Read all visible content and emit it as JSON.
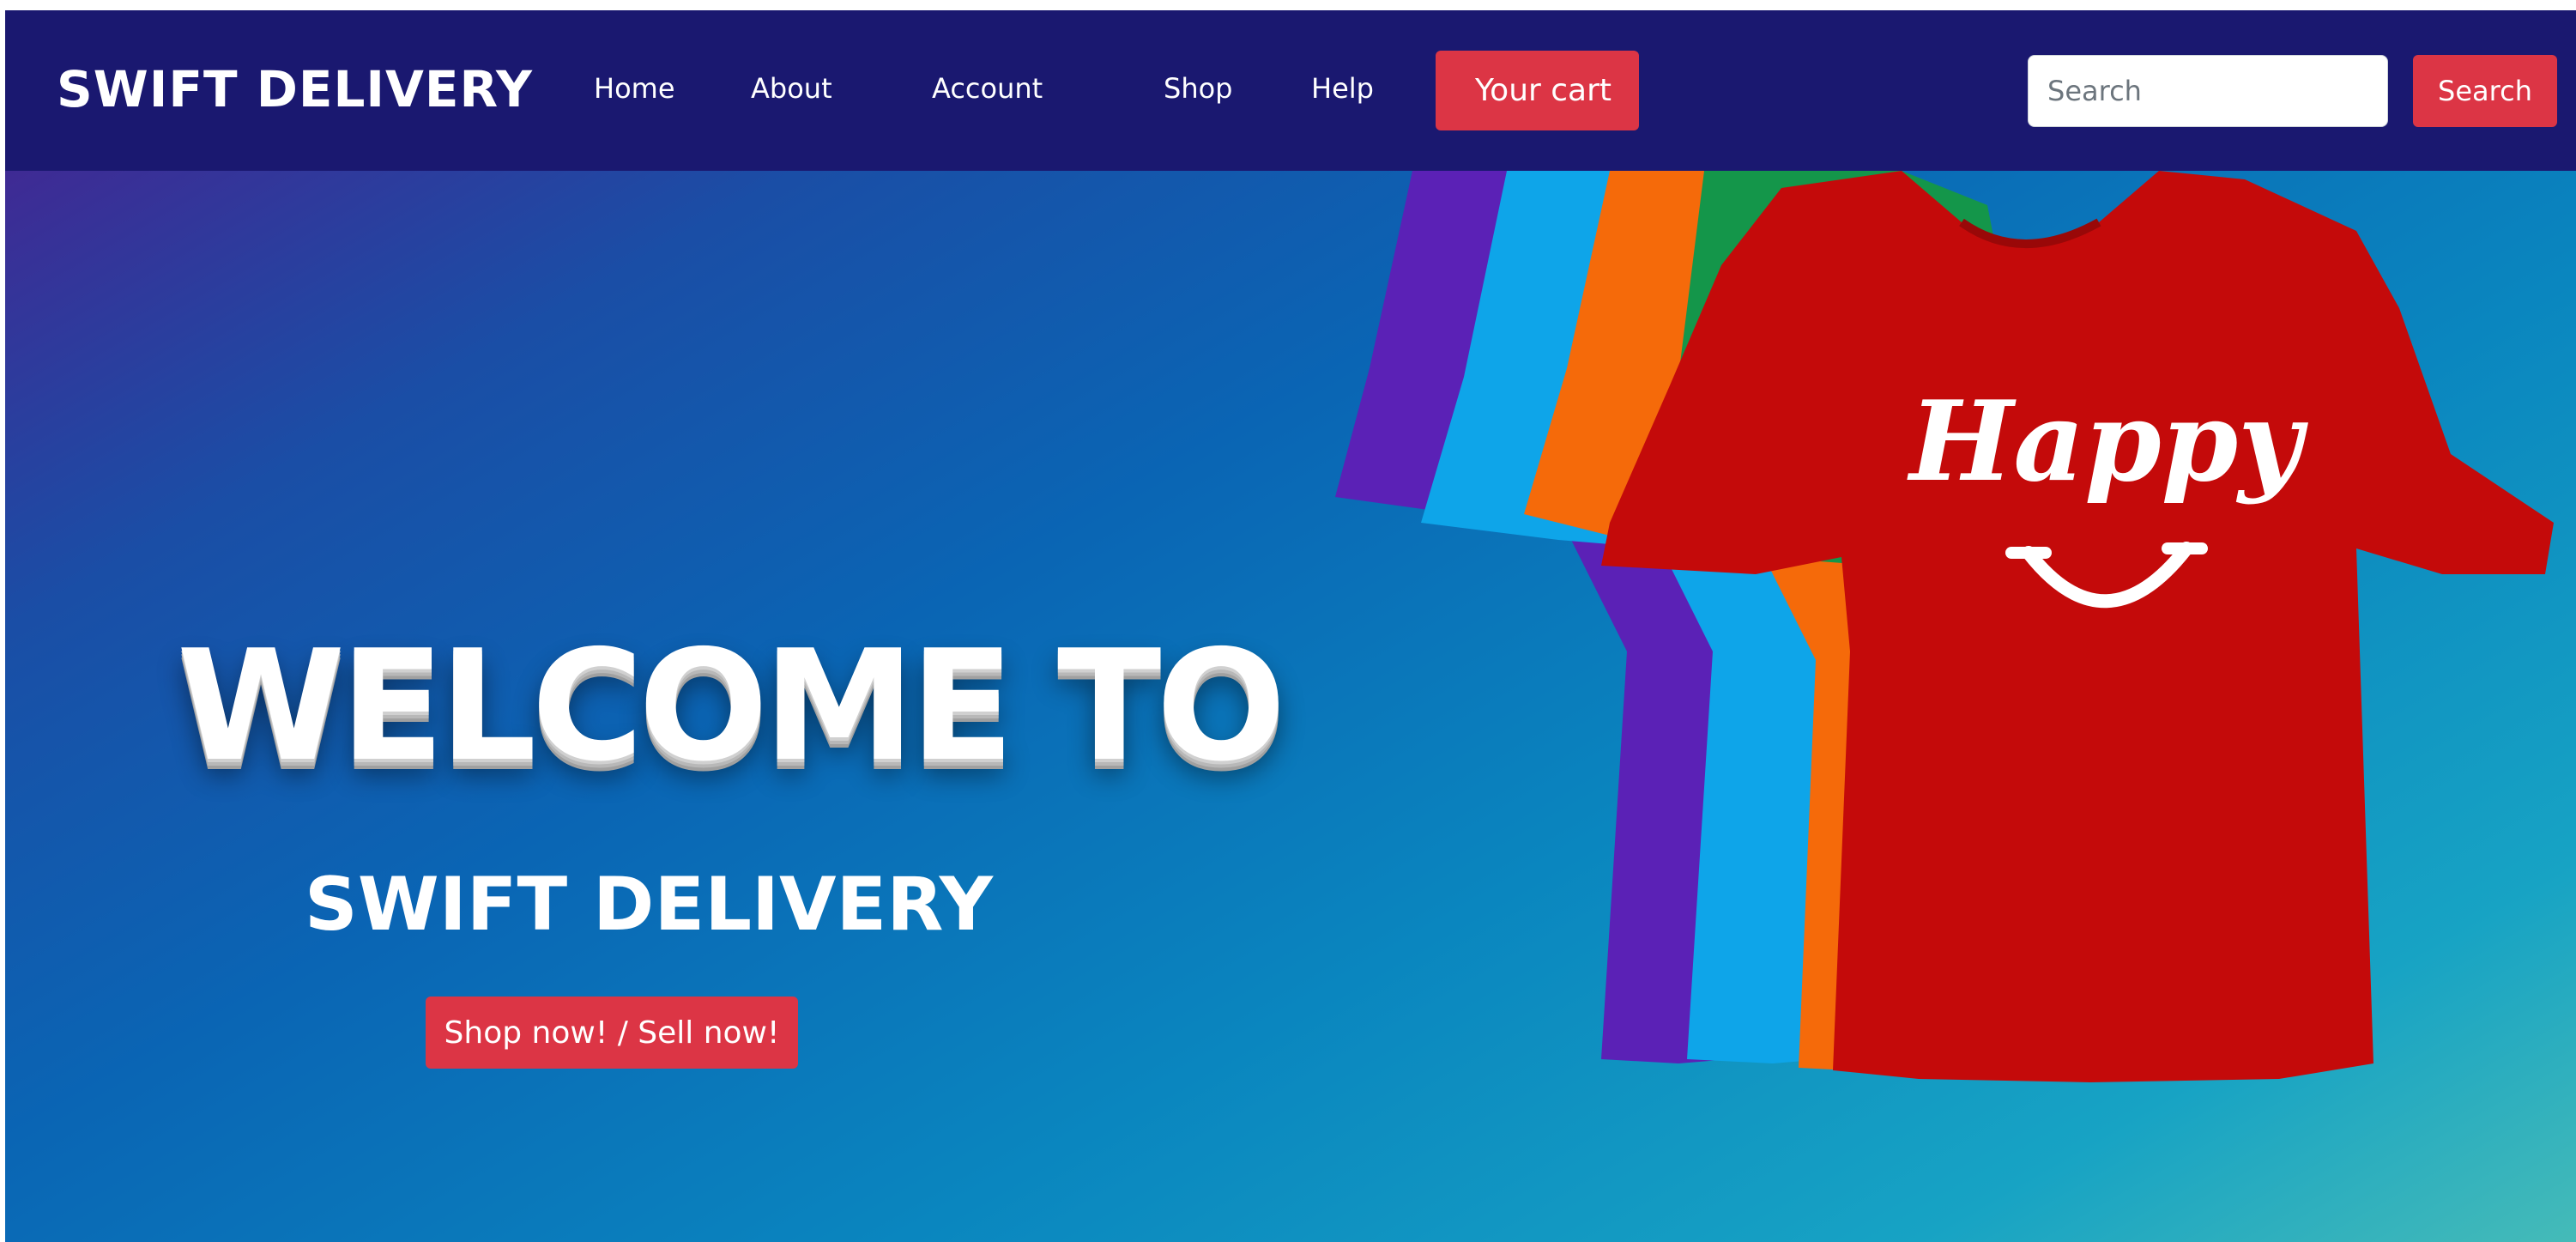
{
  "navbar": {
    "brand": "SWIFT DELIVERY",
    "links": [
      {
        "label": "Home"
      },
      {
        "label": "About"
      },
      {
        "label": "Account",
        "prefix_glyph": "",
        "suffix_glyph": ""
      },
      {
        "label": "Shop"
      },
      {
        "label": "Help"
      }
    ],
    "cart": {
      "label": "Your cart",
      "glyph": ""
    },
    "search": {
      "placeholder": "Search",
      "button_label": "Search"
    }
  },
  "hero": {
    "heading": "WELCOME TO",
    "subtitle": "SWIFT DELIVERY",
    "cta_label": "Shop now! / Sell now!",
    "shirt_print": "Happy",
    "shirt_colors": [
      "#5b21b6",
      "#0ea5e9",
      "#f56a0a",
      "#14964a",
      "#c40a0a"
    ]
  },
  "colors": {
    "navbar_bg": "#1a1870",
    "accent": "#dc3545"
  },
  "icons": {
    "account_prefix": "user-icon",
    "account_suffix": "caret-down-icon",
    "cart": "cart-icon"
  }
}
